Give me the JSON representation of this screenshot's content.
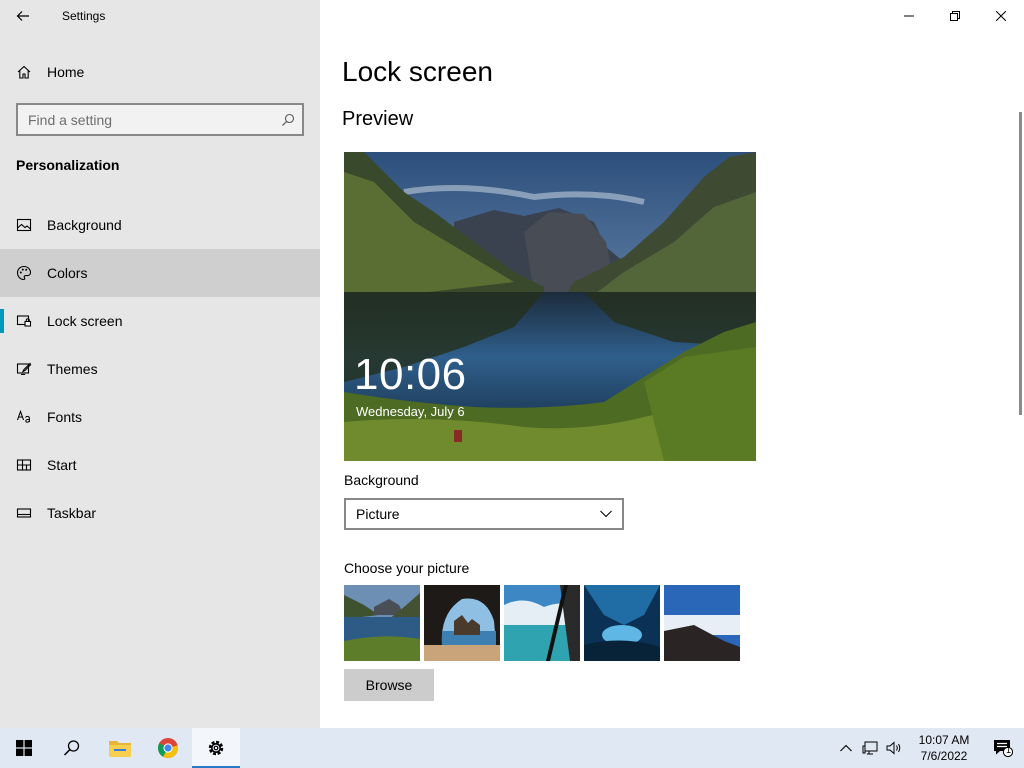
{
  "app": {
    "title": "Settings"
  },
  "sidebar": {
    "home_label": "Home",
    "search_placeholder": "Find a setting",
    "section": "Personalization",
    "items": [
      {
        "label": "Background",
        "icon": "picture-icon"
      },
      {
        "label": "Colors",
        "icon": "palette-icon"
      },
      {
        "label": "Lock screen",
        "icon": "lock-screen-icon"
      },
      {
        "label": "Themes",
        "icon": "themes-icon"
      },
      {
        "label": "Fonts",
        "icon": "fonts-icon"
      },
      {
        "label": "Start",
        "icon": "start-layout-icon"
      },
      {
        "label": "Taskbar",
        "icon": "taskbar-icon"
      }
    ],
    "hovered_item": "Colors",
    "selected_item": "Lock screen"
  },
  "main": {
    "title": "Lock screen",
    "preview_heading": "Preview",
    "preview_time": "10:06",
    "preview_date": "Wednesday, July 6",
    "background_label": "Background",
    "background_value": "Picture",
    "choose_label": "Choose your picture",
    "browse_label": "Browse"
  },
  "taskbar": {
    "apps": [
      "start-icon",
      "search-icon",
      "file-explorer-icon",
      "chrome-icon",
      "settings-icon"
    ],
    "active_app": "settings-icon",
    "clock_time": "10:07 AM",
    "clock_date": "7/6/2022",
    "notification_count": "1"
  },
  "colors": {
    "accent": "#0099bc",
    "sidebar_bg": "#e6e6e6",
    "taskbar_bg": "#dfe8f3"
  }
}
